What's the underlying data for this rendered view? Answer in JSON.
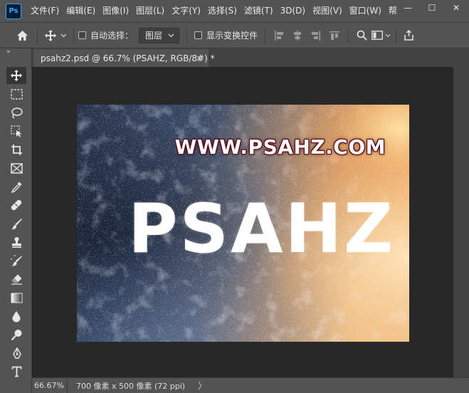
{
  "app": {
    "logo_text": "Ps"
  },
  "menu": {
    "items": [
      "文件(F)",
      "编辑(E)",
      "图像(I)",
      "图层(L)",
      "文字(Y)",
      "选择(S)",
      "滤镜(T)",
      "3D(D)",
      "视图(V)",
      "窗口(W)",
      "帮"
    ]
  },
  "window_controls": {
    "minimize": "—",
    "maximize": "☐",
    "close": "✕"
  },
  "options_bar": {
    "auto_select_label": "自动选择：",
    "auto_select_target": "图层",
    "show_transform_label": "显示变换控件"
  },
  "toolbar": {
    "collapse_glyph": "»"
  },
  "document_tab": {
    "title": "psahz2.psd @ 66.7% (PSAHZ, RGB/8#) *",
    "close_glyph": "×"
  },
  "canvas": {
    "url_text": "WWW.PSAHZ.COM",
    "main_text": "PSAHZ"
  },
  "status_bar": {
    "zoom": "66.67%",
    "doc_info": "700 像素 x 500 像素 (72 ppi)",
    "arrow": "〉"
  },
  "colors": {
    "ui_panel": "#535353",
    "workspace": "#282828",
    "ps_blue": "#31a8ff",
    "url_outline": "#6a0a18"
  }
}
